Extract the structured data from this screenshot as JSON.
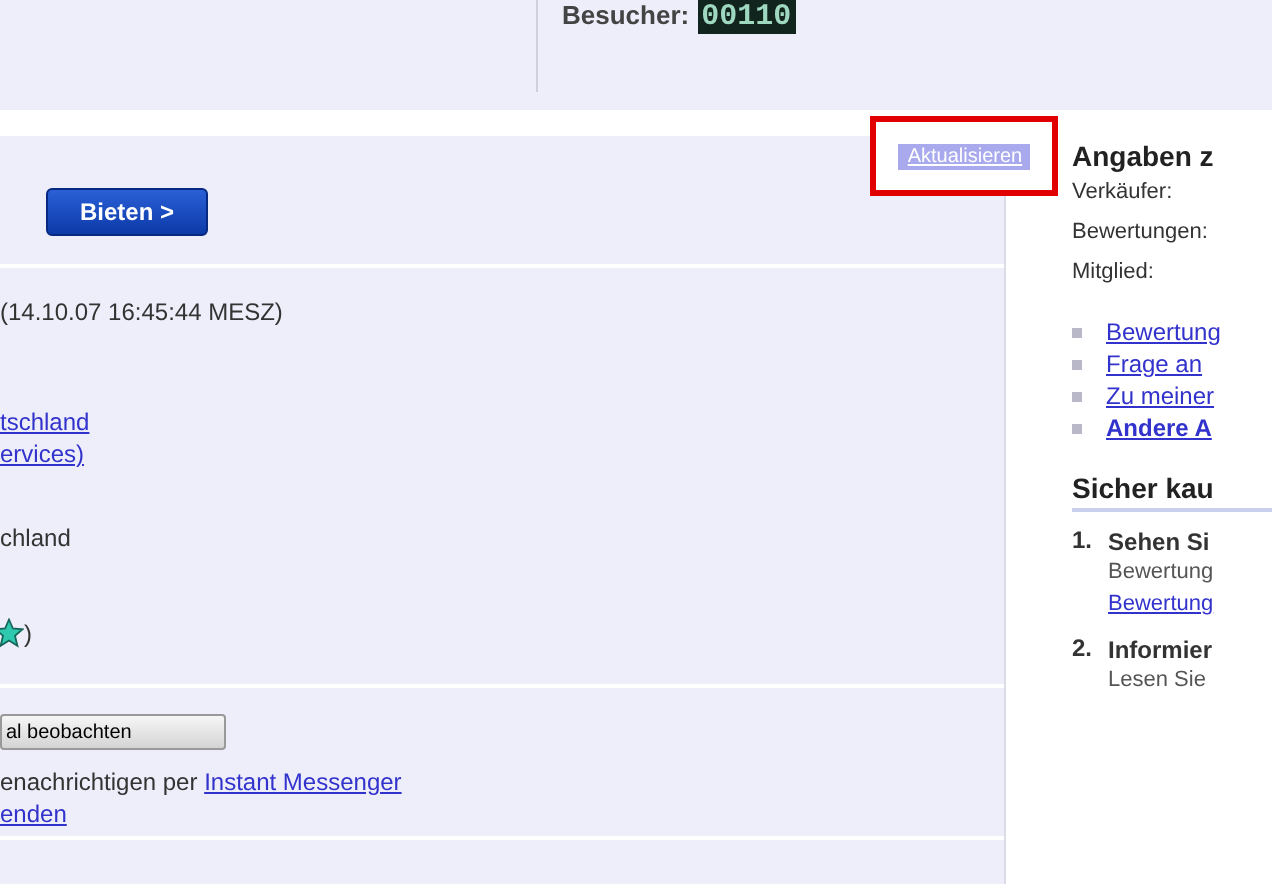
{
  "header": {
    "visitors_label": "Besucher:",
    "visitors_count": "00110"
  },
  "refresh_link": "Aktualisieren",
  "bid_button": "Bieten >",
  "end_time": "(14.10.07 16:45:44 MESZ)",
  "shipping_links": [
    "tschland",
    "ervices)"
  ],
  "location": "chland",
  "rating": {
    "suffix": " )"
  },
  "watch_button": "al beobachten",
  "notify": {
    "text": "enachrichtigen per ",
    "link": "Instant Messenger",
    "link2": "enden"
  },
  "seller_panel": {
    "title": "Angaben z",
    "fields": [
      "Verkäufer:",
      "Bewertungen:",
      "Mitglied:"
    ],
    "links": [
      {
        "label": "Bewertung",
        "bold": false
      },
      {
        "label": "Frage an",
        "bold": false
      },
      {
        "label": "Zu meiner",
        "bold": false
      },
      {
        "label": "Andere A",
        "bold": true
      }
    ]
  },
  "safe_panel": {
    "title": "Sicher kau",
    "steps": [
      {
        "number": "1.",
        "title": "Sehen Si",
        "lines": [
          {
            "kind": "text",
            "text": "Bewertung"
          },
          {
            "kind": "link",
            "text": "Bewertung"
          }
        ]
      },
      {
        "number": "2.",
        "title": "Informier",
        "lines": [
          {
            "kind": "text",
            "text": "Lesen Sie"
          }
        ]
      }
    ]
  }
}
